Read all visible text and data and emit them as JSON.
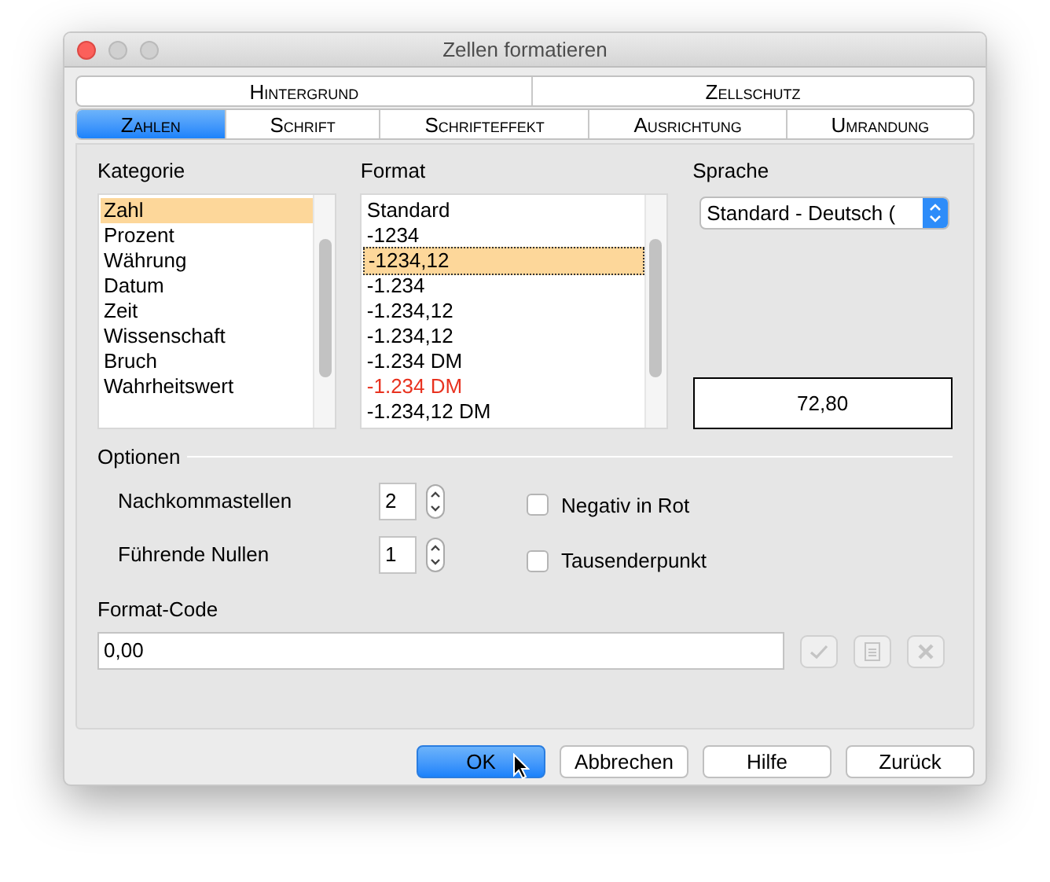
{
  "window": {
    "title": "Zellen formatieren"
  },
  "tab_rows": [
    [
      {
        "label": "Hintergrund",
        "selected": false
      },
      {
        "label": "Zellschutz",
        "selected": false
      }
    ],
    [
      {
        "label": "Zahlen",
        "selected": true
      },
      {
        "label": "Schrift",
        "selected": false
      },
      {
        "label": "Schrifteffekt",
        "selected": false
      },
      {
        "label": "Ausrichtung",
        "selected": false
      },
      {
        "label": "Umrandung",
        "selected": false
      }
    ]
  ],
  "category": {
    "label": "Kategorie",
    "items": [
      {
        "label": "Zahl",
        "selected": true
      },
      {
        "label": "Prozent",
        "selected": false
      },
      {
        "label": "Währung",
        "selected": false
      },
      {
        "label": "Datum",
        "selected": false
      },
      {
        "label": "Zeit",
        "selected": false
      },
      {
        "label": "Wissenschaft",
        "selected": false
      },
      {
        "label": "Bruch",
        "selected": false
      },
      {
        "label": "Wahrheitswert",
        "selected": false
      }
    ]
  },
  "format": {
    "label": "Format",
    "items": [
      {
        "label": "Standard",
        "selected": false,
        "red": false
      },
      {
        "label": "-1234",
        "selected": false,
        "red": false
      },
      {
        "label": "-1234,12",
        "selected": true,
        "red": false
      },
      {
        "label": "-1.234",
        "selected": false,
        "red": false
      },
      {
        "label": "-1.234,12",
        "selected": false,
        "red": false
      },
      {
        "label": "-1.234,12",
        "selected": false,
        "red": false
      },
      {
        "label": "-1.234 DM",
        "selected": false,
        "red": false
      },
      {
        "label": "-1.234 DM",
        "selected": false,
        "red": true
      },
      {
        "label": "-1.234,12 DM",
        "selected": false,
        "red": false
      }
    ]
  },
  "language": {
    "label": "Sprache",
    "value": "Standard - Deutsch ("
  },
  "preview": "72,80",
  "options": {
    "label": "Optionen",
    "spinners": [
      {
        "label": "Nachkommastellen",
        "value": "2"
      },
      {
        "label": "Führende Nullen",
        "value": "1"
      }
    ],
    "checkboxes": [
      {
        "label": "Negativ in Rot",
        "checked": false
      },
      {
        "label": "Tausenderpunkt",
        "checked": false
      }
    ]
  },
  "format_code": {
    "label": "Format-Code",
    "value": "0,00"
  },
  "buttons": [
    {
      "label": "OK",
      "default": true
    },
    {
      "label": "Abbrechen",
      "default": false
    },
    {
      "label": "Hilfe",
      "default": false
    },
    {
      "label": "Zurück",
      "default": false
    }
  ]
}
